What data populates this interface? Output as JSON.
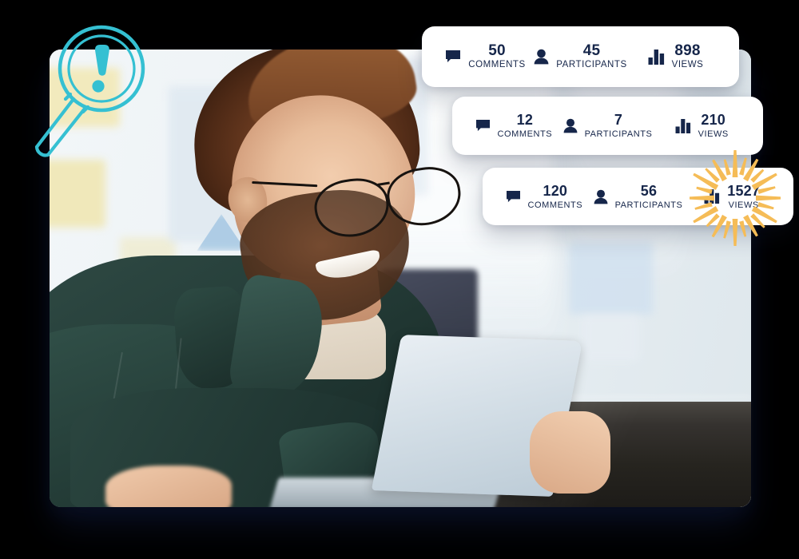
{
  "theme": {
    "accent_teal": "#35C0D2",
    "text_navy": "#16264A",
    "burst_orange": "#F5BC57",
    "card_bg": "#FFFFFF",
    "page_bg": "#000000"
  },
  "badge": {
    "name": "magnifier-alert-icon",
    "glyph": "!",
    "color": "#35C0D2"
  },
  "photo": {
    "alt": "Smiling bearded man with glasses in dark green jacket using a laptop at an office table, woman in cream shirt beside him"
  },
  "cards": [
    {
      "id": "card-1",
      "stats": [
        {
          "icon": "comment-icon",
          "value": "50",
          "label": "COMMENTS"
        },
        {
          "icon": "participant-icon",
          "value": "45",
          "label": "PARTICIPANTS"
        },
        {
          "icon": "views-bars-icon",
          "value": "898",
          "label": "VIEWS"
        }
      ]
    },
    {
      "id": "card-2",
      "stats": [
        {
          "icon": "comment-icon",
          "value": "12",
          "label": "COMMENTS"
        },
        {
          "icon": "participant-icon",
          "value": "7",
          "label": "PARTICIPANTS"
        },
        {
          "icon": "views-bars-icon",
          "value": "210",
          "label": "VIEWS"
        }
      ]
    },
    {
      "id": "card-3",
      "stats": [
        {
          "icon": "comment-icon",
          "value": "120",
          "label": "COMMENTS"
        },
        {
          "icon": "participant-icon",
          "value": "56",
          "label": "PARTICIPANTS"
        },
        {
          "icon": "views-bars-icon",
          "value": "1527",
          "label": "VIEWS"
        }
      ],
      "highlight": {
        "target": "views",
        "effect": "starburst",
        "color": "#F5BC57"
      }
    }
  ]
}
